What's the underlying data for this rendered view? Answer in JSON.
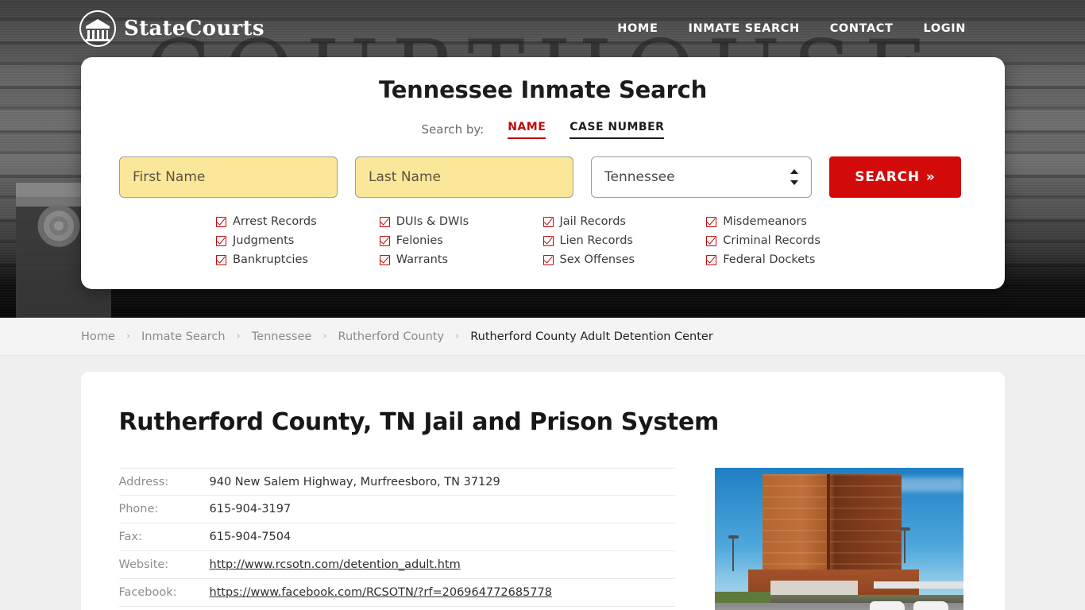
{
  "header": {
    "brand_name": "StateCourts",
    "nav": [
      {
        "label": "HOME"
      },
      {
        "label": "INMATE SEARCH"
      },
      {
        "label": "CONTACT"
      },
      {
        "label": "LOGIN"
      }
    ]
  },
  "search_card": {
    "title": "Tennessee Inmate Search",
    "search_by_label": "Search by:",
    "tabs": [
      {
        "label": "NAME",
        "active": true
      },
      {
        "label": "CASE NUMBER",
        "active": false
      }
    ],
    "first_name_placeholder": "First Name",
    "first_name_value": "",
    "last_name_placeholder": "Last Name",
    "last_name_value": "",
    "state_selected": "Tennessee",
    "state_options": [
      "Tennessee"
    ],
    "search_button": "SEARCH",
    "search_button_chevron": "»",
    "record_types": [
      "Arrest Records",
      "DUIs & DWIs",
      "Jail Records",
      "Misdemeanors",
      "Judgments",
      "Felonies",
      "Lien Records",
      "Criminal Records",
      "Bankruptcies",
      "Warrants",
      "Sex Offenses",
      "Federal Dockets"
    ]
  },
  "hero": {
    "background_word": "COURTHOUSE"
  },
  "breadcrumb": {
    "separator": "›",
    "items": [
      {
        "label": "Home",
        "current": false
      },
      {
        "label": "Inmate Search",
        "current": false
      },
      {
        "label": "Tennessee",
        "current": false
      },
      {
        "label": "Rutherford County",
        "current": false
      },
      {
        "label": "Rutherford County Adult Detention Center",
        "current": true
      }
    ]
  },
  "content": {
    "page_title": "Rutherford County, TN Jail and Prison System",
    "info_rows": [
      {
        "label": "Address:",
        "value": "940 New Salem Highway, Murfreesboro, TN 37129",
        "is_link": false
      },
      {
        "label": "Phone:",
        "value": "615-904-3197",
        "is_link": false
      },
      {
        "label": "Fax:",
        "value": "615-904-7504",
        "is_link": false
      },
      {
        "label": "Website:",
        "value": "http://www.rcsotn.com/detention_adult.htm",
        "is_link": true
      },
      {
        "label": "Facebook:",
        "value": "https://www.facebook.com/RCSOTN/?rf=206964772685778",
        "is_link": true
      }
    ],
    "photo_alt": "Rutherford County Adult Detention Center building"
  },
  "colors": {
    "accent_red": "#d20a0a",
    "tab_active_red": "#c00b0b",
    "field_yellow": "#fbe79a",
    "page_bg": "#efefef"
  }
}
